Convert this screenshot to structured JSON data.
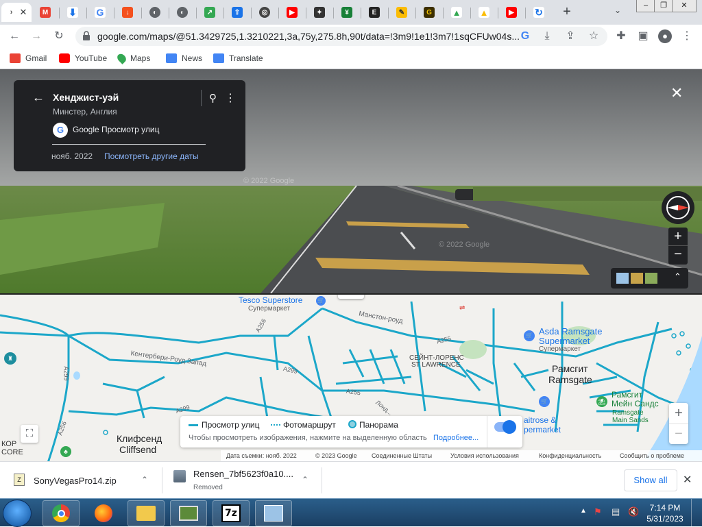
{
  "tabs": {
    "count_label": "",
    "new_tab_label": "+",
    "items": [
      {
        "icon": "firefox-tab-icon"
      },
      {
        "icon": "gmail-icon"
      },
      {
        "icon": "download-icon"
      },
      {
        "icon": "google-icon"
      },
      {
        "icon": "download-orange-icon"
      },
      {
        "icon": "globe-icon"
      },
      {
        "icon": "globe-icon"
      },
      {
        "icon": "green-share-icon"
      },
      {
        "icon": "upload-icon"
      },
      {
        "icon": "chrome-icon"
      },
      {
        "icon": "youtube-icon"
      },
      {
        "icon": "gamepad-icon"
      },
      {
        "icon": "green-doc-icon"
      },
      {
        "icon": "e-icon"
      },
      {
        "icon": "pen-icon"
      },
      {
        "icon": "g-icon"
      },
      {
        "icon": "drive-icon"
      },
      {
        "icon": "drive-icon"
      },
      {
        "icon": "youtube-icon"
      },
      {
        "icon": "loading-icon"
      }
    ]
  },
  "toolbar": {
    "url_host": "google.com",
    "url_path": "/maps/@51.3429725,1.3210221,3a,75y,275.8h,90t/data=!3m9!1e1!3m7!1sqCFUw04s..."
  },
  "bookmarks": [
    {
      "label": "Gmail",
      "icon": "gmail-icon",
      "color": "#ea4335"
    },
    {
      "label": "YouTube",
      "icon": "youtube-icon",
      "color": "#ff0000"
    },
    {
      "label": "Maps",
      "icon": "maps-pin-icon",
      "color": "#34a853"
    },
    {
      "label": "News",
      "icon": "news-icon",
      "color": "#4285f4"
    },
    {
      "label": "Translate",
      "icon": "translate-icon",
      "color": "#4285f4"
    }
  ],
  "streetview": {
    "title": "Хенджист-уэй",
    "subtitle": "Минстер, Англия",
    "google_label": "Google Просмотр улиц",
    "date": "нояб. 2022",
    "other_dates": "Посмотреть другие даты",
    "watermark": "© 2022 Google"
  },
  "map": {
    "labels": {
      "tesco": "Tesco Superstore",
      "tesco_sub": "Супермаркет",
      "manston": "Манстон-роуд",
      "canterbury": "Кентербери-Роуд Запад",
      "a256": "A256",
      "a299a": "A299",
      "a299b": "A299",
      "a299c": "A299",
      "a255a": "A255",
      "a255b": "A255",
      "a256b": "A256",
      "st_lawrence_ru": "СЕЙНТ-ЛОРЕНС",
      "st_lawrence_en": "ST LAWRENCE",
      "asda": "Asda Ramsgate",
      "asda2": "Supermarket",
      "asda_sub": "Супермаркет",
      "ramsgate_ru": "Рамсгит",
      "ramsgate_en": "Ramsgate",
      "sands_ru1": "Рамсгит",
      "sands_ru2": "Мейн Сандс",
      "sands_en1": "Ramsgate",
      "sands_en2": "Main Sands",
      "cliffsend_ru": "Клифсенд",
      "cliffsend_en": "Cliffsend",
      "waitrose": "aitrose &",
      "waitrose2": "permarket",
      "kor": "КОР",
      "core": "CORE",
      "london": "Лонд..."
    },
    "legend": {
      "street_view": "Просмотр улиц",
      "photo_route": "Фотомаршрут",
      "panorama": "Панорама",
      "hint": "Чтобы просмотреть изображения, нажмите на выделенную область",
      "more": "Подробнее..."
    },
    "attribution": {
      "date": "Дата съемки: нояб. 2022",
      "copyright": "© 2023 Google",
      "country": "Соединенные Штаты",
      "terms": "Условия использования",
      "privacy": "Конфиденциальность",
      "report": "Сообщить о проблеме"
    }
  },
  "downloads": {
    "items": [
      {
        "name": "SonyVegasPro14.zip",
        "status": ""
      },
      {
        "name": "Rensen_7bf5623f0a10....",
        "status": "Removed"
      }
    ],
    "show_all": "Show all"
  },
  "taskbar": {
    "time": "7:14 PM",
    "date": "5/31/2023"
  },
  "colors": {
    "street_view_line": "#1ca7c9",
    "map_background": "#f2f1ee",
    "accent": "#1a73e8"
  }
}
